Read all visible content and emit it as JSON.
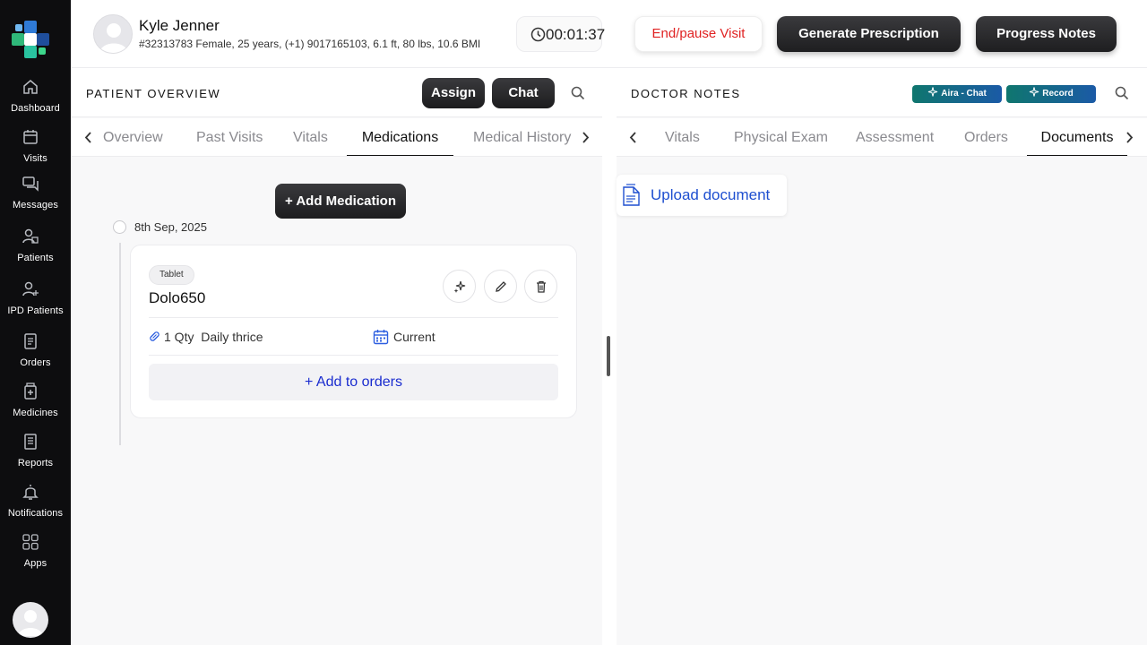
{
  "sidebar": {
    "items": [
      {
        "label": "Dashboard",
        "icon": "home-icon"
      },
      {
        "label": "Visits",
        "icon": "calendar-icon"
      },
      {
        "label": "Messages",
        "icon": "messages-icon"
      },
      {
        "label": "Patients",
        "icon": "patients-icon"
      },
      {
        "label": "IPD Patients",
        "icon": "ipd-patients-icon"
      },
      {
        "label": "Orders",
        "icon": "orders-icon"
      },
      {
        "label": "Medicines",
        "icon": "medicines-icon"
      },
      {
        "label": "Reports",
        "icon": "reports-icon"
      },
      {
        "label": "Notifications",
        "icon": "bell-icon"
      },
      {
        "label": "Apps",
        "icon": "apps-grid-icon"
      }
    ]
  },
  "header": {
    "patient_name": "Kyle Jenner",
    "patient_meta": "#32313783 Female, 25 years, (+1) 9017165103, 6.1 ft, 80 lbs, 10.6 BMI",
    "timer": "00:01:37",
    "end_visit_label": "End/pause Visit",
    "prescription_label": "Generate Prescription",
    "progress_notes_label": "Progress Notes"
  },
  "left_panel": {
    "title": "PATIENT OVERVIEW",
    "assign_label": "Assign",
    "chat_label": "Chat",
    "tabs": [
      "Overview",
      "Past Visits",
      "Vitals",
      "Medications",
      "Medical History"
    ],
    "active_tab": "Medications",
    "add_medication_label": "+ Add Medication",
    "timeline_date": "8th Sep, 2025",
    "medication": {
      "form": "Tablet",
      "name": "Dolo650",
      "dose": "1 Qty  Daily thrice",
      "status": "Current",
      "add_to_orders_label": "+ Add to orders"
    }
  },
  "right_panel": {
    "title": "DOCTOR NOTES",
    "aira_chat_label": "Aira - Chat",
    "record_label": "Record",
    "tabs": [
      "Vitals",
      "Physical Exam",
      "Assessment",
      "Orders",
      "Documents"
    ],
    "active_tab": "Documents",
    "upload_label": "Upload document"
  },
  "colors": {
    "sidebar_bg": "#0d0d0f",
    "danger": "#e02222",
    "link_blue": "#1a2ccf",
    "aira_gradient_start": "#0f766e",
    "aira_gradient_end": "#1b5aa6"
  }
}
